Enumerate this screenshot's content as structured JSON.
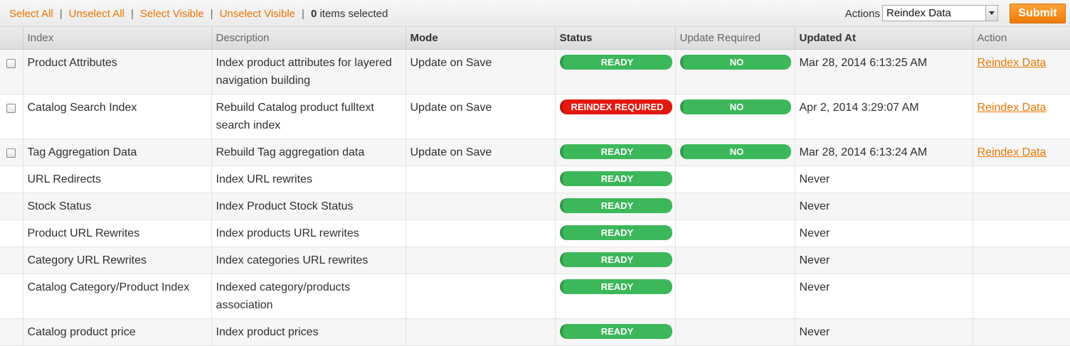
{
  "massaction": {
    "select_all": "Select All",
    "unselect_all": "Unselect All",
    "select_visible": "Select Visible",
    "unselect_visible": "Unselect Visible",
    "sep": "|",
    "count": "0",
    "count_suffix": " items selected"
  },
  "actions": {
    "label": "Actions",
    "selected": "Reindex Data",
    "submit": "Submit"
  },
  "columns": {
    "index": "Index",
    "description": "Description",
    "mode": "Mode",
    "status": "Status",
    "update_required": "Update Required",
    "updated_at": "Updated At",
    "action": "Action"
  },
  "rows": [
    {
      "index": "Product Attributes",
      "description": "Index product attributes for layered navigation building",
      "mode": "Update on Save",
      "status": "READY",
      "update_required": "NO",
      "updated_at": "Mar 28, 2014 6:13:25 AM",
      "action": "Reindex Data"
    },
    {
      "index": "Catalog Search Index",
      "description": "Rebuild Catalog product fulltext search index",
      "mode": "Update on Save",
      "status": "REINDEX REQUIRED",
      "update_required": "NO",
      "updated_at": "Apr 2, 2014 3:29:07 AM",
      "action": "Reindex Data"
    },
    {
      "index": "Tag Aggregation Data",
      "description": "Rebuild Tag aggregation data",
      "mode": "Update on Save",
      "status": "READY",
      "update_required": "NO",
      "updated_at": "Mar 28, 2014 6:13:24 AM",
      "action": "Reindex Data"
    },
    {
      "index": "URL Redirects",
      "description": "Index URL rewrites",
      "mode": "",
      "status": "READY",
      "update_required": "",
      "updated_at": "Never",
      "action": ""
    },
    {
      "index": "Stock Status",
      "description": "Index Product Stock Status",
      "mode": "",
      "status": "READY",
      "update_required": "",
      "updated_at": "Never",
      "action": ""
    },
    {
      "index": "Product URL Rewrites",
      "description": "Index products URL rewrites",
      "mode": "",
      "status": "READY",
      "update_required": "",
      "updated_at": "Never",
      "action": ""
    },
    {
      "index": "Category URL Rewrites",
      "description": "Index categories URL rewrites",
      "mode": "",
      "status": "READY",
      "update_required": "",
      "updated_at": "Never",
      "action": ""
    },
    {
      "index": "Catalog Category/Product Index",
      "description": "Indexed category/products association",
      "mode": "",
      "status": "READY",
      "update_required": "",
      "updated_at": "Never",
      "action": ""
    },
    {
      "index": "Catalog product price",
      "description": "Index product prices",
      "mode": "",
      "status": "READY",
      "update_required": "",
      "updated_at": "Never",
      "action": ""
    }
  ],
  "colors": {
    "accent_link": "#ea7601",
    "status_ready": "#3cb85b",
    "status_reindex": "#e31810",
    "submit": "#ee7a05"
  }
}
